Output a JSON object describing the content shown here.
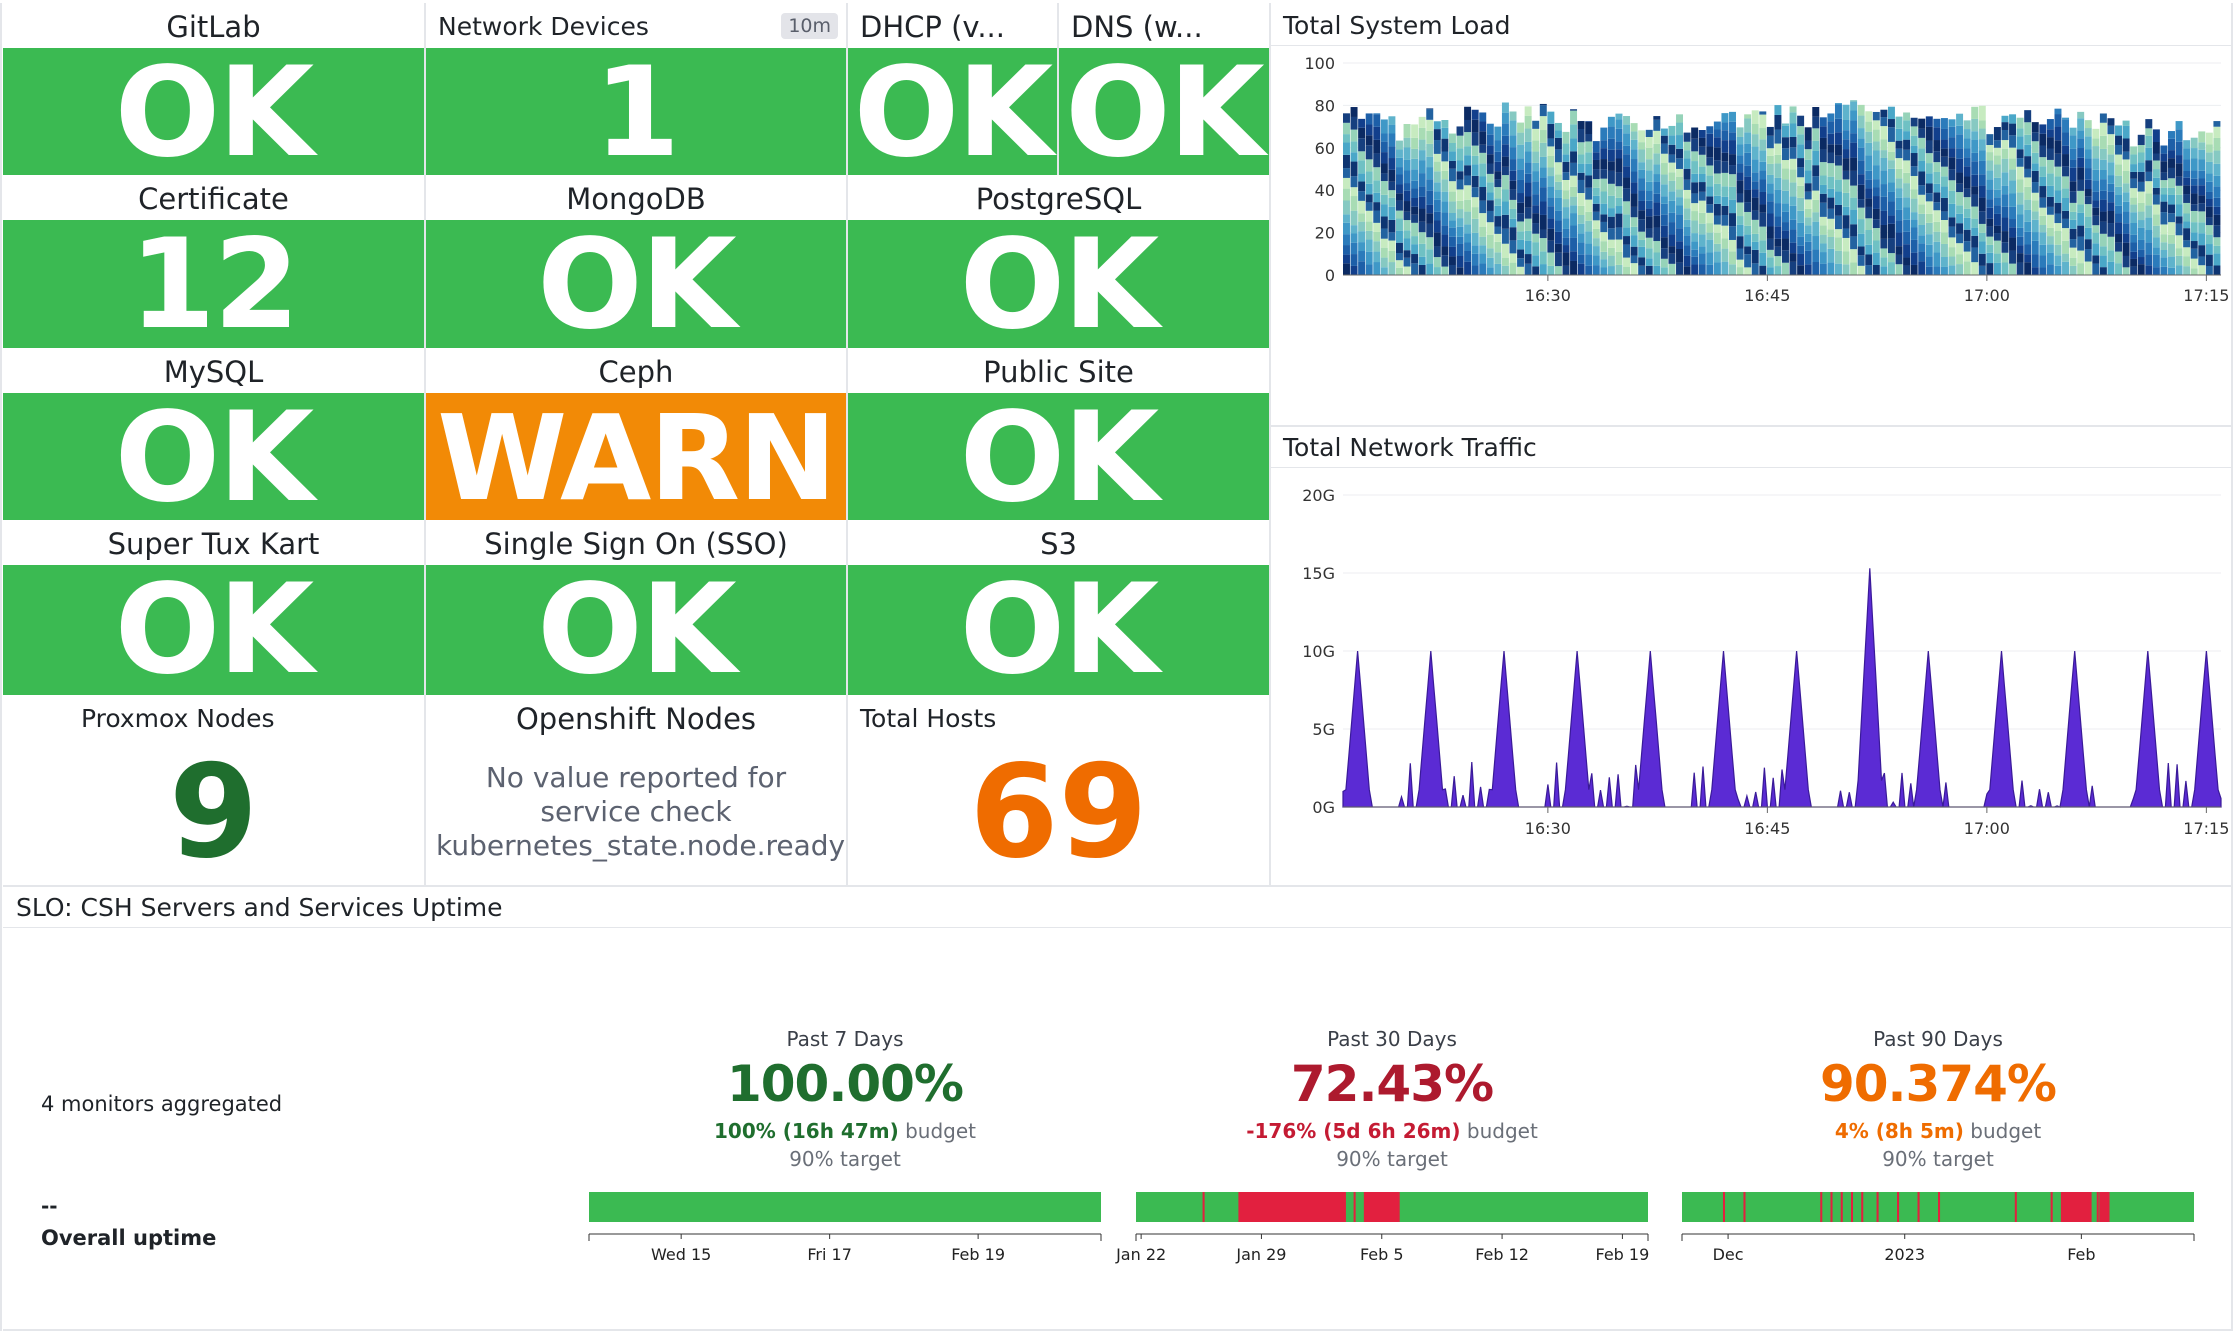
{
  "colors": {
    "ok": "#3bba52",
    "warn": "#f28a06",
    "green_text": "#1f6e2e",
    "orange_text": "#ef6c00",
    "red_text": "#ad1a2e",
    "bar_red": "#e2203f",
    "purple": "#5b2bd4"
  },
  "tiles": {
    "gitlab": {
      "title": "GitLab",
      "value": "OK",
      "status": "ok"
    },
    "network": {
      "title": "Network Devices",
      "value": "1",
      "badge": "10m",
      "status": "ok"
    },
    "dhcp": {
      "title": "DHCP (v...",
      "value": "OK",
      "status": "ok"
    },
    "dns": {
      "title": "DNS (w...",
      "value": "OK",
      "status": "ok"
    },
    "certificate": {
      "title": "Certificate",
      "value": "12",
      "status": "ok"
    },
    "mongodb": {
      "title": "MongoDB",
      "value": "OK",
      "status": "ok"
    },
    "postgresql": {
      "title": "PostgreSQL",
      "value": "OK",
      "status": "ok"
    },
    "mysql": {
      "title": "MySQL",
      "value": "OK",
      "status": "ok"
    },
    "ceph": {
      "title": "Ceph",
      "value": "WARN",
      "status": "warn"
    },
    "publicsite": {
      "title": "Public Site",
      "value": "OK",
      "status": "ok"
    },
    "supertux": {
      "title": "Super Tux Kart",
      "value": "OK",
      "status": "ok"
    },
    "sso": {
      "title": "Single Sign On (SSO)",
      "value": "OK",
      "status": "ok"
    },
    "s3": {
      "title": "S3",
      "value": "OK",
      "status": "ok"
    },
    "proxmox": {
      "title": "Proxmox Nodes",
      "value": "9"
    },
    "openshift": {
      "title": "Openshift Nodes",
      "message": "No value reported for service check kubernetes_state.node.ready"
    },
    "hosts": {
      "title": "Total Hosts",
      "value": "69"
    }
  },
  "system_load": {
    "title": "Total System Load",
    "y_ticks": [
      "100",
      "80",
      "60",
      "40",
      "20",
      "0"
    ],
    "x_ticks": [
      "16:30",
      "16:45",
      "17:00",
      "17:15"
    ]
  },
  "network_traffic": {
    "title": "Total Network Traffic",
    "y_ticks": [
      "20G",
      "15G",
      "10G",
      "5G",
      "0G"
    ],
    "x_ticks": [
      "16:30",
      "16:45",
      "17:00",
      "17:15"
    ]
  },
  "chart_data": [
    {
      "type": "area",
      "title": "Total System Load",
      "stacked": true,
      "ylim": [
        0,
        100
      ],
      "x_range": [
        "16:16",
        "17:16"
      ],
      "note_series": "many stacked host series in blue/green palette",
      "x": [
        "16:16",
        "16:20",
        "16:24",
        "16:28",
        "16:32",
        "16:36",
        "16:40",
        "16:44",
        "16:48",
        "16:52",
        "16:56",
        "17:00",
        "17:04",
        "17:08",
        "17:12",
        "17:16"
      ],
      "total": [
        80,
        74,
        75,
        79,
        76,
        73,
        72,
        74,
        78,
        82,
        78,
        76,
        74,
        72,
        70,
        69
      ]
    },
    {
      "type": "area",
      "title": "Total Network Traffic",
      "ylim": [
        0,
        20
      ],
      "unit": "G",
      "x_range": [
        "16:16",
        "17:16"
      ],
      "x": [
        "16:17",
        "16:22",
        "16:27",
        "16:32",
        "16:37",
        "16:42",
        "16:47",
        "16:52",
        "16:56",
        "17:01",
        "17:06",
        "17:11",
        "17:15"
      ],
      "peaks": [
        10,
        10,
        10,
        10,
        10,
        10,
        10,
        15.3,
        10,
        10,
        10,
        10,
        10
      ]
    }
  ],
  "slo": {
    "title": "SLO: CSH Servers and Services Uptime",
    "monitors": "4 monitors aggregated",
    "dash": "--",
    "overall": "Overall uptime",
    "windows": [
      {
        "label": "Past 7 Days",
        "pct": "100.00%",
        "budget_val": "100% (16h 47m)",
        "budget_word": "budget",
        "target": "90% target",
        "ticks": [
          "Wed 15",
          "Fri 17",
          "Feb 19"
        ]
      },
      {
        "label": "Past 30 Days",
        "pct": "72.43%",
        "budget_val": "-176% (5d 6h 26m)",
        "budget_word": "budget",
        "target": "90% target",
        "ticks": [
          "Jan 22",
          "Jan 29",
          "Feb 5",
          "Feb 12",
          "Feb 19"
        ]
      },
      {
        "label": "Past 90 Days",
        "pct": "90.374%",
        "budget_val": "4% (8h 5m)",
        "budget_word": "budget",
        "target": "90% target",
        "ticks": [
          "Dec",
          "2023",
          "Feb"
        ]
      }
    ]
  }
}
